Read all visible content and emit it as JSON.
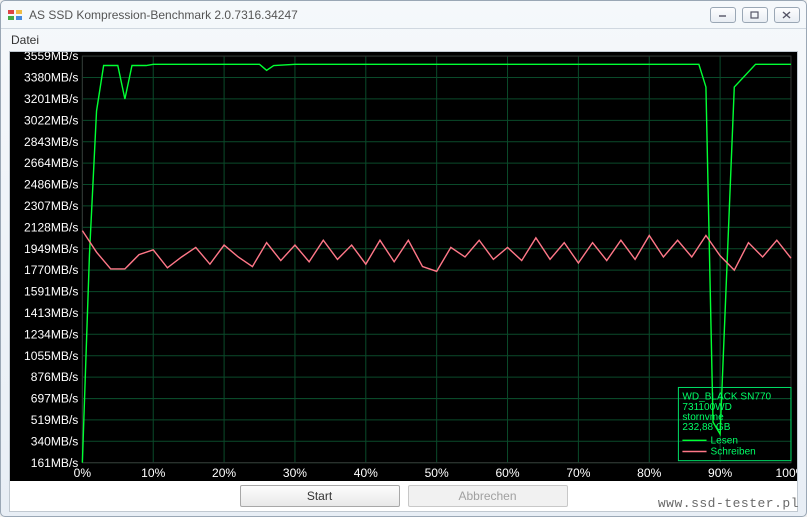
{
  "window": {
    "title": "AS SSD Kompression-Benchmark 2.0.7316.34247"
  },
  "menu": {
    "file": "Datei"
  },
  "buttons": {
    "start": "Start",
    "cancel": "Abbrechen"
  },
  "legend": {
    "device_line1": "WD_BLACK SN770",
    "device_line2": "731100WD",
    "driver": "stornvme",
    "capacity": "232,88 GB",
    "read": "Lesen",
    "write": "Schreiben"
  },
  "colors": {
    "read": "#00ff33",
    "write": "#ff7788",
    "grid": "#0a4a2a",
    "axis": "#ffffff"
  },
  "watermark": "www.ssd-tester.pl",
  "chart_data": {
    "type": "line",
    "xlabel": "",
    "ylabel": "",
    "x_ticks": [
      "0%",
      "10%",
      "20%",
      "30%",
      "40%",
      "50%",
      "60%",
      "70%",
      "80%",
      "90%",
      "100%"
    ],
    "y_ticks": [
      "161MB/s",
      "340MB/s",
      "519MB/s",
      "697MB/s",
      "876MB/s",
      "1055MB/s",
      "1234MB/s",
      "1413MB/s",
      "1591MB/s",
      "1770MB/s",
      "1949MB/s",
      "2128MB/s",
      "2307MB/s",
      "2486MB/s",
      "2664MB/s",
      "2843MB/s",
      "3022MB/s",
      "3201MB/s",
      "3380MB/s",
      "3559MB/s"
    ],
    "xlim": [
      0,
      100
    ],
    "ylim": [
      161,
      3559
    ],
    "grid": true,
    "series": [
      {
        "name": "Lesen",
        "color": "#00ff33",
        "x": [
          0,
          1,
          2,
          3,
          4,
          5,
          6,
          7,
          8,
          9,
          10,
          15,
          20,
          25,
          26,
          27,
          30,
          40,
          50,
          60,
          70,
          80,
          86,
          87,
          88,
          89,
          90,
          92,
          95,
          100
        ],
        "y": [
          161,
          1900,
          3100,
          3480,
          3480,
          3480,
          3200,
          3480,
          3480,
          3480,
          3490,
          3490,
          3490,
          3490,
          3440,
          3480,
          3490,
          3490,
          3490,
          3490,
          3490,
          3490,
          3490,
          3490,
          3300,
          500,
          400,
          3300,
          3490,
          3490
        ]
      },
      {
        "name": "Schreiben",
        "color": "#ff7788",
        "x": [
          0,
          2,
          4,
          6,
          8,
          10,
          12,
          14,
          16,
          18,
          20,
          22,
          24,
          26,
          28,
          30,
          32,
          34,
          36,
          38,
          40,
          42,
          44,
          46,
          48,
          50,
          52,
          54,
          56,
          58,
          60,
          62,
          64,
          66,
          68,
          70,
          72,
          74,
          76,
          78,
          80,
          82,
          84,
          86,
          88,
          90,
          92,
          94,
          96,
          98,
          100
        ],
        "y": [
          2100,
          1920,
          1780,
          1780,
          1900,
          1940,
          1790,
          1880,
          1960,
          1820,
          1980,
          1880,
          1800,
          2000,
          1850,
          1980,
          1840,
          2020,
          1860,
          1980,
          1820,
          2020,
          1840,
          2020,
          1800,
          1760,
          1960,
          1880,
          2020,
          1860,
          1960,
          1850,
          2040,
          1860,
          2000,
          1830,
          2000,
          1850,
          2020,
          1860,
          2060,
          1880,
          2020,
          1880,
          2060,
          1890,
          1770,
          2000,
          1880,
          2020,
          1870
        ]
      }
    ]
  }
}
